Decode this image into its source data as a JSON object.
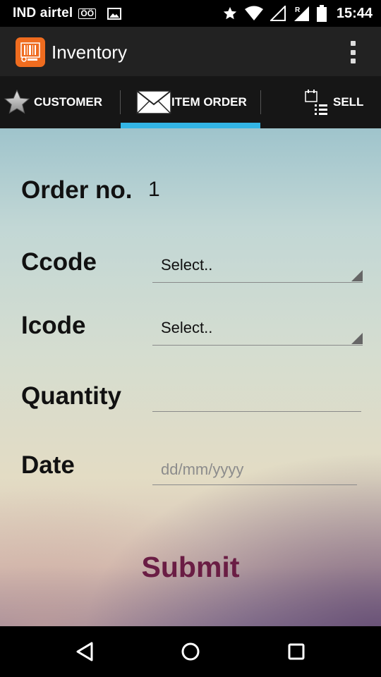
{
  "status_bar": {
    "carrier": "IND airtel",
    "network_type": "ÖÖ",
    "time": "15:44",
    "icons": [
      "gallery-icon",
      "star-icon",
      "wifi-icon",
      "signal-icon",
      "roaming-signal-icon",
      "battery-icon"
    ]
  },
  "app_bar": {
    "title": "Inventory",
    "logo_icon": "barcode-app-icon",
    "menu_icon": "overflow-menu-icon"
  },
  "tabs": [
    {
      "label": "CUSTOMER",
      "icon": "star-icon",
      "selected": false
    },
    {
      "label": "ITEM ORDER",
      "icon": "envelope-icon",
      "selected": true
    },
    {
      "label": "SELL",
      "icon": "list-icon",
      "selected": false
    }
  ],
  "accent_color": "#33b5e5",
  "form": {
    "order_label": "Order no.",
    "order_value": "1",
    "ccode_label": "Ccode",
    "ccode_value": "Select..",
    "icode_label": "Icode",
    "icode_value": "Select..",
    "quantity_label": "Quantity",
    "quantity_value": "",
    "date_label": "Date",
    "date_placeholder": "dd/mm/yyyy",
    "submit_label": "Submit",
    "submit_color": "#6a1d44"
  },
  "nav_bar": {
    "icons": [
      "back-icon",
      "home-icon",
      "recents-icon"
    ]
  }
}
